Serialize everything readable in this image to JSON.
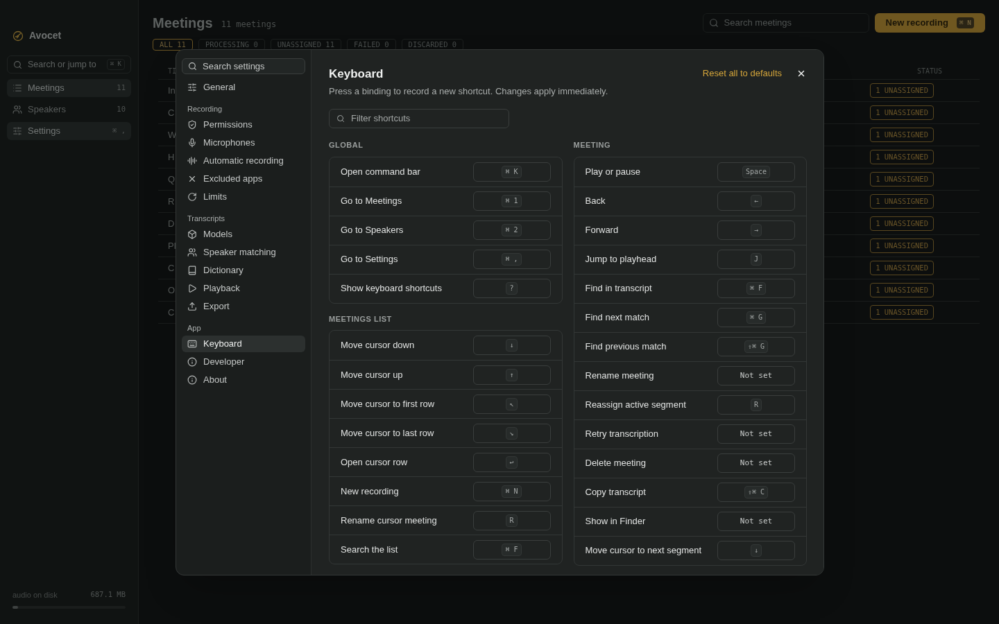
{
  "app": {
    "brand": "Avocet",
    "search": {
      "placeholder": "Search or jump to",
      "shortcut": "⌘ K"
    },
    "nav": [
      {
        "label": "Meetings",
        "count": "11",
        "selected": true
      },
      {
        "label": "Speakers",
        "count": "10",
        "selected": false
      },
      {
        "label": "Settings",
        "count": "⌘ ,",
        "selected": true
      }
    ],
    "storage": {
      "label": "audio on disk",
      "value": "687.1 MB",
      "level": 0.05
    }
  },
  "main": {
    "title": "Meetings",
    "count": "11 meetings",
    "search": {
      "placeholder": "Search meetings"
    },
    "new_button": {
      "label": "New recording",
      "shortcut": "⌘ N"
    },
    "filters": [
      {
        "label": "ALL 11",
        "selected": true
      },
      {
        "label": "PROCESSING 0",
        "selected": false
      },
      {
        "label": "UNASSIGNED 11",
        "selected": false
      },
      {
        "label": "FAILED 0",
        "selected": false
      },
      {
        "label": "DISCARDED 0",
        "selected": false
      }
    ],
    "table": {
      "columns": [
        "TI",
        "STATUS"
      ],
      "rows": [
        {
          "title": "In",
          "status": "1 UNASSIGNED"
        },
        {
          "title": "C",
          "status": "1 UNASSIGNED"
        },
        {
          "title": "W",
          "status": "1 UNASSIGNED"
        },
        {
          "title": "H",
          "status": "1 UNASSIGNED"
        },
        {
          "title": "Q",
          "status": "1 UNASSIGNED"
        },
        {
          "title": "R",
          "status": "1 UNASSIGNED"
        },
        {
          "title": "D",
          "status": "1 UNASSIGNED"
        },
        {
          "title": "Pl",
          "status": "1 UNASSIGNED"
        },
        {
          "title": "C",
          "status": "1 UNASSIGNED"
        },
        {
          "title": "O",
          "status": "1 UNASSIGNED"
        },
        {
          "title": "C",
          "status": "1 UNASSIGNED"
        }
      ]
    }
  },
  "settings": {
    "search": {
      "placeholder": "Search settings"
    },
    "groups": [
      {
        "items": [
          {
            "label": "General",
            "selected": false
          }
        ]
      },
      {
        "heading": "Recording",
        "items": [
          {
            "label": "Permissions",
            "selected": false
          },
          {
            "label": "Microphones",
            "selected": false
          },
          {
            "label": "Automatic recording",
            "selected": false
          },
          {
            "label": "Excluded apps",
            "selected": false
          },
          {
            "label": "Limits",
            "selected": false
          }
        ]
      },
      {
        "heading": "Transcripts",
        "items": [
          {
            "label": "Models",
            "selected": false
          },
          {
            "label": "Speaker matching",
            "selected": false
          },
          {
            "label": "Dictionary",
            "selected": false
          },
          {
            "label": "Playback",
            "selected": false
          },
          {
            "label": "Export",
            "selected": false
          }
        ]
      },
      {
        "heading": "App",
        "items": [
          {
            "label": "Keyboard",
            "selected": true
          },
          {
            "label": "Developer",
            "selected": false
          },
          {
            "label": "About",
            "selected": false
          }
        ]
      }
    ],
    "page": {
      "title": "Keyboard",
      "description": "Press a binding to record a new shortcut. Changes apply immediately.",
      "reset": "Reset all to defaults",
      "filter": {
        "placeholder": "Filter shortcuts"
      },
      "columns": [
        [
          {
            "title": "GLOBAL",
            "rows": [
              {
                "action": "Open command bar",
                "binding": {
                  "kind": "keys",
                  "text": "⌘ K"
                }
              },
              {
                "action": "Go to Meetings",
                "binding": {
                  "kind": "keys",
                  "text": "⌘ 1"
                }
              },
              {
                "action": "Go to Speakers",
                "binding": {
                  "kind": "keys",
                  "text": "⌘ 2"
                }
              },
              {
                "action": "Go to Settings",
                "binding": {
                  "kind": "keys",
                  "text": "⌘ ,"
                }
              },
              {
                "action": "Show keyboard shortcuts",
                "binding": {
                  "kind": "keys",
                  "text": "?"
                }
              }
            ]
          },
          {
            "title": "MEETINGS LIST",
            "rows": [
              {
                "action": "Move cursor down",
                "binding": {
                  "kind": "keys",
                  "text": "↓"
                }
              },
              {
                "action": "Move cursor up",
                "binding": {
                  "kind": "keys",
                  "text": "↑"
                }
              },
              {
                "action": "Move cursor to first row",
                "binding": {
                  "kind": "keys",
                  "text": "↖"
                }
              },
              {
                "action": "Move cursor to last row",
                "binding": {
                  "kind": "keys",
                  "text": "↘"
                }
              },
              {
                "action": "Open cursor row",
                "binding": {
                  "kind": "keys",
                  "text": "↩"
                }
              },
              {
                "action": "New recording",
                "binding": {
                  "kind": "keys",
                  "text": "⌘ N"
                }
              },
              {
                "action": "Rename cursor meeting",
                "binding": {
                  "kind": "keys",
                  "text": "R"
                }
              },
              {
                "action": "Search the list",
                "binding": {
                  "kind": "keys",
                  "text": "⌘ F"
                }
              }
            ]
          }
        ],
        [
          {
            "title": "MEETING",
            "rows": [
              {
                "action": "Play or pause",
                "binding": {
                  "kind": "keys",
                  "text": "Space"
                }
              },
              {
                "action": "Back",
                "binding": {
                  "kind": "keys",
                  "text": "←"
                }
              },
              {
                "action": "Forward",
                "binding": {
                  "kind": "keys",
                  "text": "→"
                }
              },
              {
                "action": "Jump to playhead",
                "binding": {
                  "kind": "keys",
                  "text": "J"
                }
              },
              {
                "action": "Find in transcript",
                "binding": {
                  "kind": "keys",
                  "text": "⌘ F"
                }
              },
              {
                "action": "Find next match",
                "binding": {
                  "kind": "keys",
                  "text": "⌘ G"
                }
              },
              {
                "action": "Find previous match",
                "binding": {
                  "kind": "keys",
                  "text": "⇧⌘ G"
                }
              },
              {
                "action": "Rename meeting",
                "binding": {
                  "kind": "unset",
                  "text": "Not set"
                }
              },
              {
                "action": "Reassign active segment",
                "binding": {
                  "kind": "keys",
                  "text": "R"
                }
              },
              {
                "action": "Retry transcription",
                "binding": {
                  "kind": "unset",
                  "text": "Not set"
                }
              },
              {
                "action": "Delete meeting",
                "binding": {
                  "kind": "unset",
                  "text": "Not set"
                }
              },
              {
                "action": "Copy transcript",
                "binding": {
                  "kind": "keys",
                  "text": "⇧⌘ C"
                }
              },
              {
                "action": "Show in Finder",
                "binding": {
                  "kind": "unset",
                  "text": "Not set"
                }
              },
              {
                "action": "Move cursor to next segment",
                "binding": {
                  "kind": "keys",
                  "text": "↓"
                }
              }
            ]
          }
        ]
      ]
    }
  }
}
